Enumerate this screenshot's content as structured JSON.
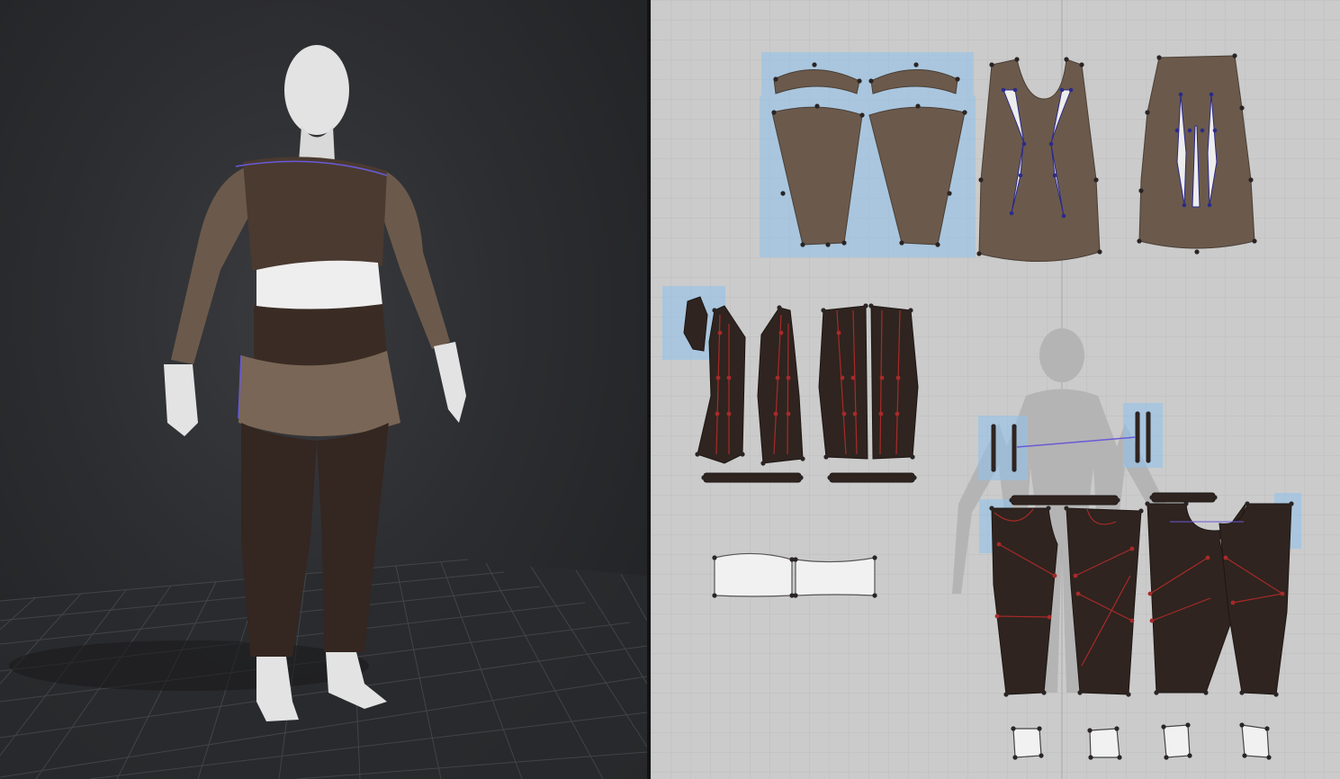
{
  "colors": {
    "viewport_bg": "#2c2d30",
    "workspace_bg": "#cbcbcb",
    "grid_line": "#bdbdbd",
    "fabric_light_brown": "#6b5a4c",
    "fabric_dark_brown": "#2f241f",
    "fabric_white": "#f1f1f1",
    "selection_blue": "#8ec4ee",
    "seam_red": "#a82a2a",
    "selection_outline": "#6a5ad8",
    "avatar_skin": "#e6e6e6"
  },
  "views": {
    "left": "3d-viewport",
    "right": "2d-pattern-window"
  },
  "icons": {
    "avatar": "avatar-icon",
    "avatar_silhouette": "avatar-silhouette-icon"
  }
}
